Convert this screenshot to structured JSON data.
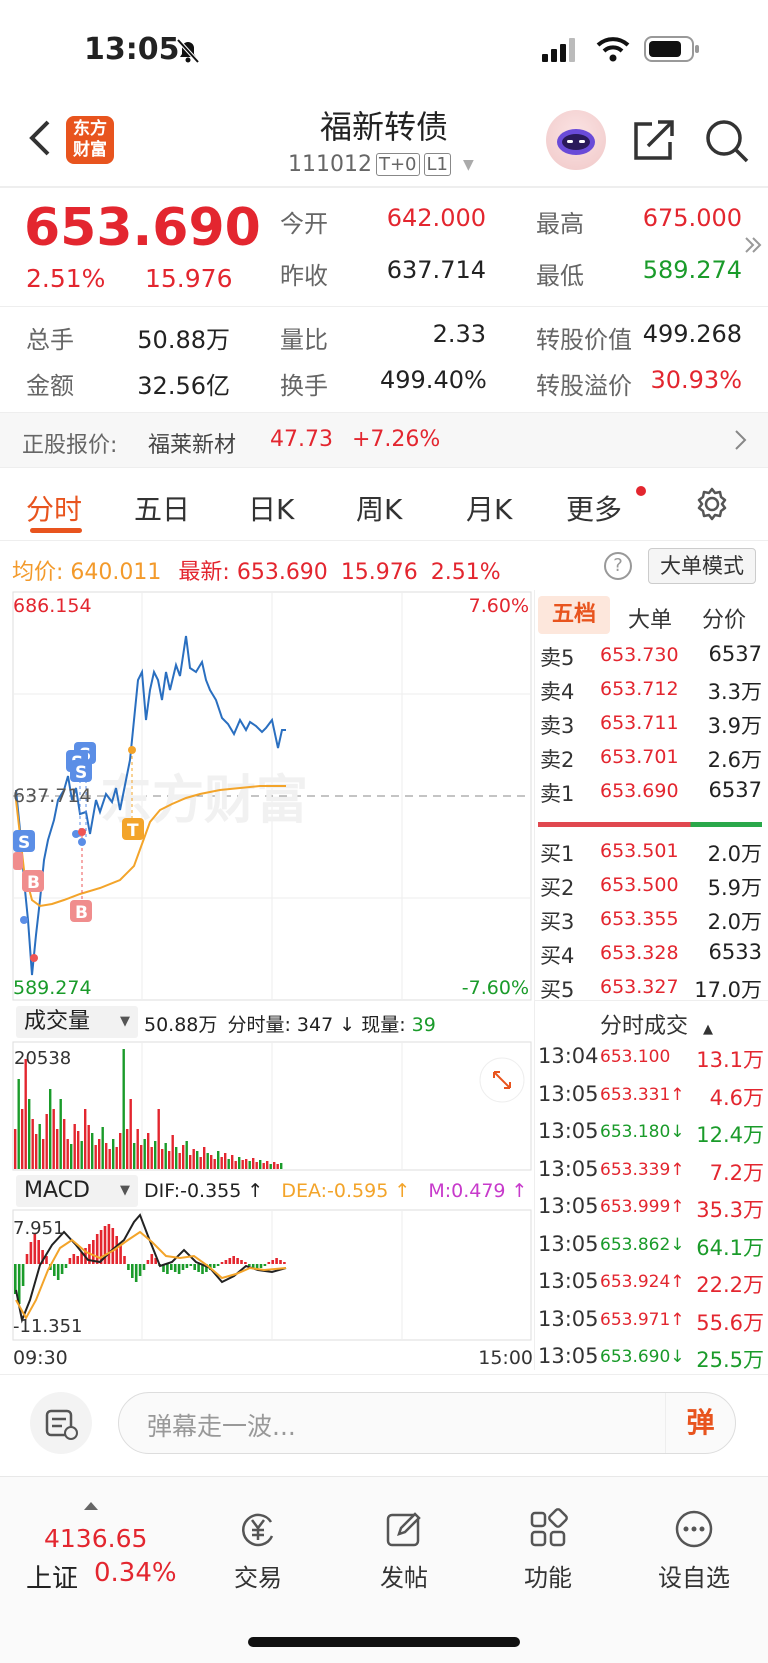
{
  "status": {
    "time": "13:05"
  },
  "header": {
    "title": "福新转债",
    "code": "111012",
    "badge_t0": "T+0",
    "badge_l1": "L1",
    "logo_line1": "东方",
    "logo_line2": "财富"
  },
  "quote": {
    "price": "653.690",
    "change_pct": "2.51%",
    "change": "15.976",
    "open_label": "今开",
    "open": "642.000",
    "high_label": "最高",
    "high": "675.000",
    "prev_label": "昨收",
    "prev": "637.714",
    "low_label": "最低",
    "low": "589.274",
    "vol_label": "总手",
    "vol": "50.88万",
    "ratio_label": "量比",
    "ratio": "2.33",
    "conv_value_label": "转股价值",
    "conv_value": "499.268",
    "amount_label": "金额",
    "amount": "32.56亿",
    "turnover_label": "换手",
    "turnover": "499.40%",
    "premium_label": "转股溢价",
    "premium": "30.93%"
  },
  "underlying": {
    "label": "正股报价:",
    "name": "福莱新材",
    "price": "47.73",
    "change": "+7.26%"
  },
  "tabs": [
    "分时",
    "五日",
    "日K",
    "周K",
    "月K",
    "更多"
  ],
  "chart_info": {
    "avg_label": "均价:",
    "avg": "640.011",
    "latest_label": "最新:",
    "latest": "653.690",
    "chg": "15.976",
    "pct": "2.51%",
    "mode_button": "大单模式"
  },
  "chart_labels": {
    "top_price": "686.154",
    "top_pct": "7.60%",
    "mid_price": "637.714",
    "bot_price": "589.274",
    "bot_pct": "-7.60%",
    "watermark": "东方财富"
  },
  "volume_bar": {
    "selector": "成交量",
    "total": "50.88万",
    "minute_label": "分时量:",
    "minute": "347",
    "current_label": "现量:",
    "current": "39",
    "max": "20538"
  },
  "macd_bar": {
    "selector": "MACD",
    "dif": "DIF:-0.355 ↑",
    "dea": "DEA:-0.595 ↑",
    "m": "M:0.479 ↑",
    "max": "7.951",
    "min": "-11.351"
  },
  "time_axis": {
    "start": "09:30",
    "end": "15:00"
  },
  "orderbook": {
    "tabs": [
      "五档",
      "大单",
      "分价"
    ],
    "asks": [
      {
        "label": "卖5",
        "price": "653.730",
        "vol": "6537"
      },
      {
        "label": "卖4",
        "price": "653.712",
        "vol": "3.3万"
      },
      {
        "label": "卖3",
        "price": "653.711",
        "vol": "3.9万"
      },
      {
        "label": "卖2",
        "price": "653.701",
        "vol": "2.6万"
      },
      {
        "label": "卖1",
        "price": "653.690",
        "vol": "6537"
      }
    ],
    "bids": [
      {
        "label": "买1",
        "price": "653.501",
        "vol": "2.0万"
      },
      {
        "label": "买2",
        "price": "653.500",
        "vol": "5.9万"
      },
      {
        "label": "买3",
        "price": "653.355",
        "vol": "2.0万"
      },
      {
        "label": "买4",
        "price": "653.328",
        "vol": "6533"
      },
      {
        "label": "买5",
        "price": "653.327",
        "vol": "17.0万"
      }
    ]
  },
  "trades": {
    "title": "分时成交",
    "rows": [
      {
        "time": "13:04",
        "price": "653.100",
        "arrow": "",
        "vol": "13.1万",
        "color": "red"
      },
      {
        "time": "13:05",
        "price": "653.331↑",
        "arrow": "",
        "vol": "4.6万",
        "color": "red"
      },
      {
        "time": "13:05",
        "price": "653.180↓",
        "arrow": "",
        "vol": "12.4万",
        "color": "green"
      },
      {
        "time": "13:05",
        "price": "653.339↑",
        "arrow": "",
        "vol": "7.2万",
        "color": "red"
      },
      {
        "time": "13:05",
        "price": "653.999↑",
        "arrow": "",
        "vol": "35.3万",
        "color": "red"
      },
      {
        "time": "13:05",
        "price": "653.862↓",
        "arrow": "",
        "vol": "64.1万",
        "color": "green"
      },
      {
        "time": "13:05",
        "price": "653.924↑",
        "arrow": "",
        "vol": "22.2万",
        "color": "red"
      },
      {
        "time": "13:05",
        "price": "653.971↑",
        "arrow": "",
        "vol": "55.6万",
        "color": "red"
      },
      {
        "time": "13:05",
        "price": "653.690↓",
        "arrow": "",
        "vol": "25.5万",
        "color": "green"
      }
    ]
  },
  "comment": {
    "placeholder": "弹幕走一波...",
    "send": "弹"
  },
  "bottom": {
    "index_value": "4136.65",
    "index_name": "上证",
    "index_pct": "0.34%",
    "items": [
      "交易",
      "发帖",
      "功能",
      "设自选"
    ]
  },
  "colors": {
    "up": "#e3262f",
    "down": "#1a9b2a",
    "accent": "#e8541e",
    "avg": "#f3a42a",
    "price_line": "#2a6fc0"
  }
}
